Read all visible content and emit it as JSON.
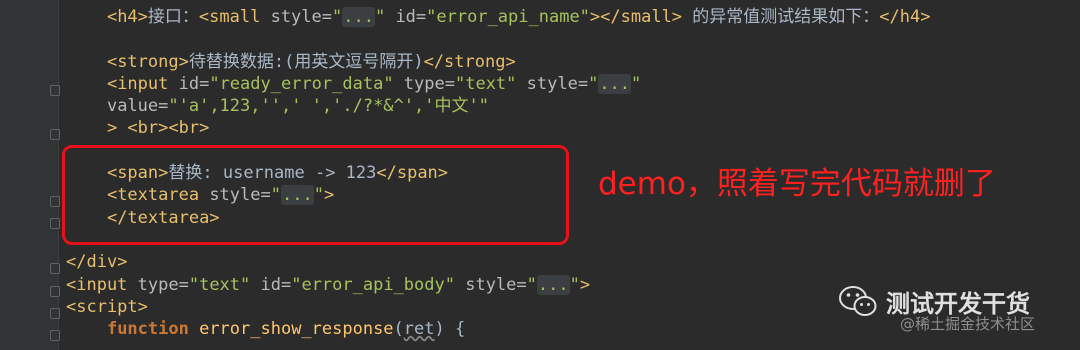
{
  "code_lines": [
    [
      [
        "txt",
        "    "
      ],
      [
        "tag",
        "<h4>"
      ],
      [
        "txt",
        "接口："
      ],
      [
        "tag",
        "<small "
      ],
      [
        "attr",
        "style="
      ],
      [
        "val",
        "\""
      ],
      [
        "ellip",
        "..."
      ],
      [
        "val",
        "\""
      ],
      [
        "attr",
        " id="
      ],
      [
        "val",
        "\"error_api_name\""
      ],
      [
        "tag",
        "></small>"
      ],
      [
        "txt",
        " 的异常值测试结果如下："
      ],
      [
        "tag",
        "</h4>"
      ]
    ],
    [],
    [
      [
        "txt",
        "    "
      ],
      [
        "tag",
        "<strong>"
      ],
      [
        "txt",
        "待替换数据:(用英文逗号隔开)"
      ],
      [
        "tag",
        "</strong>"
      ]
    ],
    [
      [
        "txt",
        "    "
      ],
      [
        "tag",
        "<input "
      ],
      [
        "attr",
        "id="
      ],
      [
        "val",
        "\"ready_error_data\""
      ],
      [
        "attr",
        " type="
      ],
      [
        "val",
        "\"text\""
      ],
      [
        "attr",
        " style="
      ],
      [
        "val",
        "\""
      ],
      [
        "ellip",
        "..."
      ],
      [
        "val",
        "\""
      ]
    ],
    [
      [
        "txt",
        "    "
      ],
      [
        "attr",
        "value="
      ],
      [
        "val",
        "\"'a',123,'',' ','./?*&^','中文'\""
      ]
    ],
    [
      [
        "txt",
        "    "
      ],
      [
        "tag",
        "> <br><br>"
      ]
    ],
    [],
    [
      [
        "txt",
        "    "
      ],
      [
        "tag",
        "<span>"
      ],
      [
        "txt",
        "替换: username -> 123"
      ],
      [
        "tag",
        "</span>"
      ]
    ],
    [
      [
        "txt",
        "    "
      ],
      [
        "tag",
        "<textarea "
      ],
      [
        "attr",
        "style="
      ],
      [
        "val",
        "\""
      ],
      [
        "ellip",
        "..."
      ],
      [
        "val",
        "\""
      ],
      [
        "tag",
        ">"
      ]
    ],
    [
      [
        "txt",
        "    "
      ],
      [
        "tag",
        "</textarea>"
      ]
    ],
    [],
    [
      [
        "tag",
        "</div>"
      ]
    ],
    [
      [
        "tag",
        "<input "
      ],
      [
        "attr",
        "type="
      ],
      [
        "val",
        "\"text\""
      ],
      [
        "attr",
        " id="
      ],
      [
        "val",
        "\"error_api_body\""
      ],
      [
        "attr",
        " style="
      ],
      [
        "val",
        "\""
      ],
      [
        "ellip",
        "..."
      ],
      [
        "val",
        "\""
      ],
      [
        "tag",
        ">"
      ]
    ],
    [
      [
        "tag",
        "<script>"
      ]
    ],
    [
      [
        "txt",
        "    "
      ],
      [
        "kw",
        "function "
      ],
      [
        "fn",
        "error_show_response"
      ],
      [
        "txt",
        "("
      ],
      [
        "wavy",
        "ret"
      ],
      [
        "txt",
        ") {"
      ]
    ]
  ],
  "annotation": "demo，照着写完代码就删了",
  "watermark": {
    "title": "测试开发干货",
    "subtitle": "@稀土掘金技术社区",
    "icon": "wechat-icon"
  }
}
